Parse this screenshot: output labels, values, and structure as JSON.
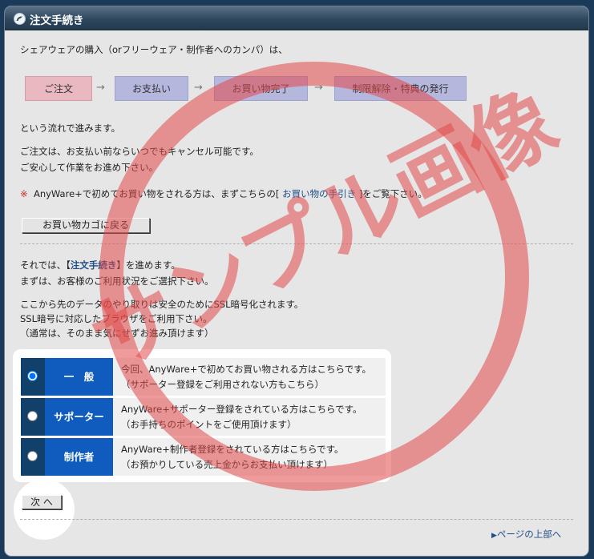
{
  "window": {
    "title": "注文手続き"
  },
  "intro": "シェアウェアの購入（orフリーウェア・制作者へのカンパ）は、",
  "flow": {
    "steps": [
      "ご注文",
      "お支払い",
      "お買い物完了",
      "制限解除・特典の発行"
    ],
    "arrow": "→",
    "step_colors": [
      "#eab8c0",
      "#b5b7dd",
      "#b5b7dd",
      "#b5b7dd"
    ]
  },
  "flow_note": "という流れで進みます。",
  "cancel_note_1": "ご注文は、お支払い前ならいつでもキャンセル可能です。",
  "cancel_note_2": "ご安心して作業をお進め下さい。",
  "guide": {
    "mark": "※",
    "prefix": "AnyWare+で初めてお買い物をされる方は、まずこちらの[",
    "link": "お買い物の手引き",
    "suffix": "]をご覧下さい。"
  },
  "back_button": "お買い物カゴに戻る",
  "proceed": {
    "prefix": "それでは、【",
    "highlight": "注文手続き",
    "suffix": "】を進めます。"
  },
  "select_note": "まずは、お客様のご利用状況をご選択下さい。",
  "ssl_1": "ここから先のデータのやり取りは安全のためにSSL暗号化されます。",
  "ssl_2": "SSL暗号に対応したブラウザをご利用下さい。",
  "ssl_3": "（通常は、そのまま気にせずお進み頂けます）",
  "options": [
    {
      "label": "一　般",
      "desc1": "今回、AnyWare+で初めてお買い物される方はこちらです。",
      "desc2": "（サポーター登録をご利用されない方もこちら）",
      "selected": true
    },
    {
      "label": "サポーター",
      "desc1": "AnyWare+サポーター登録をされている方はこちらです。",
      "desc2": "（お手持ちのポイントをご使用頂けます）",
      "selected": false
    },
    {
      "label": "制作者",
      "desc1": "AnyWare+制作者登録をされている方はこちらです。",
      "desc2": "（お預かりしている売上金からお支払い頂けます）",
      "selected": false
    }
  ],
  "next_button": "次 へ",
  "page_top": {
    "arrow": "▶",
    "label": "ページの上部へ"
  },
  "watermark": "サンプル画像",
  "colors": {
    "accent_red": "#cc2222",
    "link_blue": "#1f4e87",
    "option_label": "#0f5cbe",
    "option_radio": "#11406a"
  }
}
